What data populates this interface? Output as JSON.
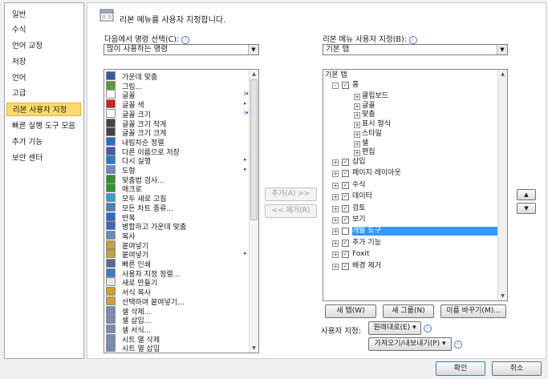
{
  "nav": {
    "items": [
      {
        "label": "일반"
      },
      {
        "label": "수식"
      },
      {
        "label": "언어 교정"
      },
      {
        "label": "저장"
      },
      {
        "label": "언어"
      },
      {
        "label": "고급"
      },
      {
        "label": "리본 사용자 지정",
        "selected": true
      },
      {
        "label": "빠른 실행 도구 모음"
      },
      {
        "label": "추가 기능"
      },
      {
        "label": "보안 센터"
      }
    ]
  },
  "header": {
    "title": "리본 메뉴를 사용자 지정합니다."
  },
  "left_panel": {
    "label": "다음에서 명령 선택(C):",
    "combo_value": "많이 사용하는 명령",
    "commands": [
      {
        "label": "가운데 맞춤",
        "color": "#3a5a9c"
      },
      {
        "label": "그림...",
        "color": "#5a9a3a"
      },
      {
        "label": "글꼴",
        "color": "#ffffff",
        "sub": "I▾"
      },
      {
        "label": "글꼴 색",
        "color": "#d22020",
        "sub": "▸"
      },
      {
        "label": "글꼴 크기",
        "color": "#ffffff",
        "sub": "I▾"
      },
      {
        "label": "글꼴 크기 작게",
        "color": "#444444"
      },
      {
        "label": "글꼴 크기 크게",
        "color": "#444444"
      },
      {
        "label": "내림차순 정렬",
        "color": "#2d6bc8"
      },
      {
        "label": "다른 이름으로 저장",
        "color": "#4a5aa8"
      },
      {
        "label": "다시 실행",
        "color": "#2a7ac8",
        "sub": "▸"
      },
      {
        "label": "도형",
        "color": "#6a8ac8",
        "sub": "▸"
      },
      {
        "label": "맞춤법 검사...",
        "color": "#3a8a3a"
      },
      {
        "label": "매크로",
        "color": "#2a9a2a"
      },
      {
        "label": "모두 새로 고침",
        "color": "#3aa0d0"
      },
      {
        "label": "모든 차트 종류...",
        "color": "#5a7ab8"
      },
      {
        "label": "반복",
        "color": "#2a6ad0"
      },
      {
        "label": "병합하고 가운데 맞춤",
        "color": "#3a6ab8"
      },
      {
        "label": "복사",
        "color": "#6a8ab8"
      },
      {
        "label": "붙여넣기",
        "color": "#c8a040"
      },
      {
        "label": "붙여넣기",
        "color": "#c8a040",
        "sub": "▸"
      },
      {
        "label": "빠른 인쇄",
        "color": "#5a6a8a"
      },
      {
        "label": "사용자 지정 정렬...",
        "color": "#3a7ac8"
      },
      {
        "label": "새로 만들기",
        "color": "#e8e8e8"
      },
      {
        "label": "서식 복사",
        "color": "#d0a030"
      },
      {
        "label": "선택하여 붙여넣기...",
        "color": "#c8a040"
      },
      {
        "label": "셀 삭제...",
        "color": "#7a8ab0"
      },
      {
        "label": "셀 삽입...",
        "color": "#7a8ab0"
      },
      {
        "label": "셀 서식...",
        "color": "#7a8ab0"
      },
      {
        "label": "시트 열 삭제",
        "color": "#7a8ab0"
      },
      {
        "label": "시트 열 삽입",
        "color": "#7a8ab0"
      }
    ]
  },
  "buttons": {
    "add": "추가(A) >>",
    "remove": "<< 제거(R)",
    "new_tab": "새 탭(W)",
    "new_group": "새 그룹(N)",
    "rename": "이름 바꾸기(M)...",
    "ok": "확인",
    "cancel": "취소",
    "move_up": "▲",
    "move_down": "▼"
  },
  "right_panel": {
    "label": "리본 메뉴 사용자 지정(B):",
    "combo_value": "기본 탭",
    "tree_header": "기본 탭",
    "home": "홈",
    "home_groups": [
      "클립보드",
      "글꼴",
      "맞춤",
      "표시 형식",
      "스타일",
      "셀",
      "편집"
    ],
    "tabs": [
      {
        "label": "삽입",
        "checked": true
      },
      {
        "label": "페이지 레이아웃",
        "checked": true
      },
      {
        "label": "수식",
        "checked": true
      },
      {
        "label": "데이터",
        "checked": true
      },
      {
        "label": "검토",
        "checked": true
      },
      {
        "label": "보기",
        "checked": true
      },
      {
        "label": "개발 도구",
        "checked": false,
        "selected": true
      },
      {
        "label": "추가 기능",
        "checked": true
      },
      {
        "label": "Foxit",
        "checked": true
      },
      {
        "label": "배경 제거",
        "checked": true
      }
    ]
  },
  "customize": {
    "label": "사용자 지정:",
    "reset": "원래대로(E) ▾",
    "import_export": "가져오기/내보내기(P) ▾"
  }
}
